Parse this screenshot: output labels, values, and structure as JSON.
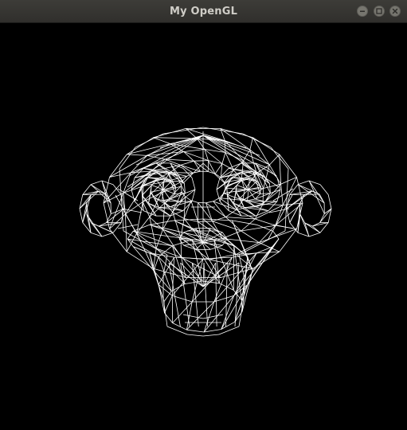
{
  "window": {
    "title": "My OpenGL",
    "background": "#000000",
    "controls": {
      "minimize": "minimize-icon",
      "maximize": "maximize-icon",
      "close": "close-icon"
    }
  },
  "scene": {
    "object": "suzanne-monkey-head",
    "render_mode": "wireframe",
    "line_color": "#ffffff"
  }
}
